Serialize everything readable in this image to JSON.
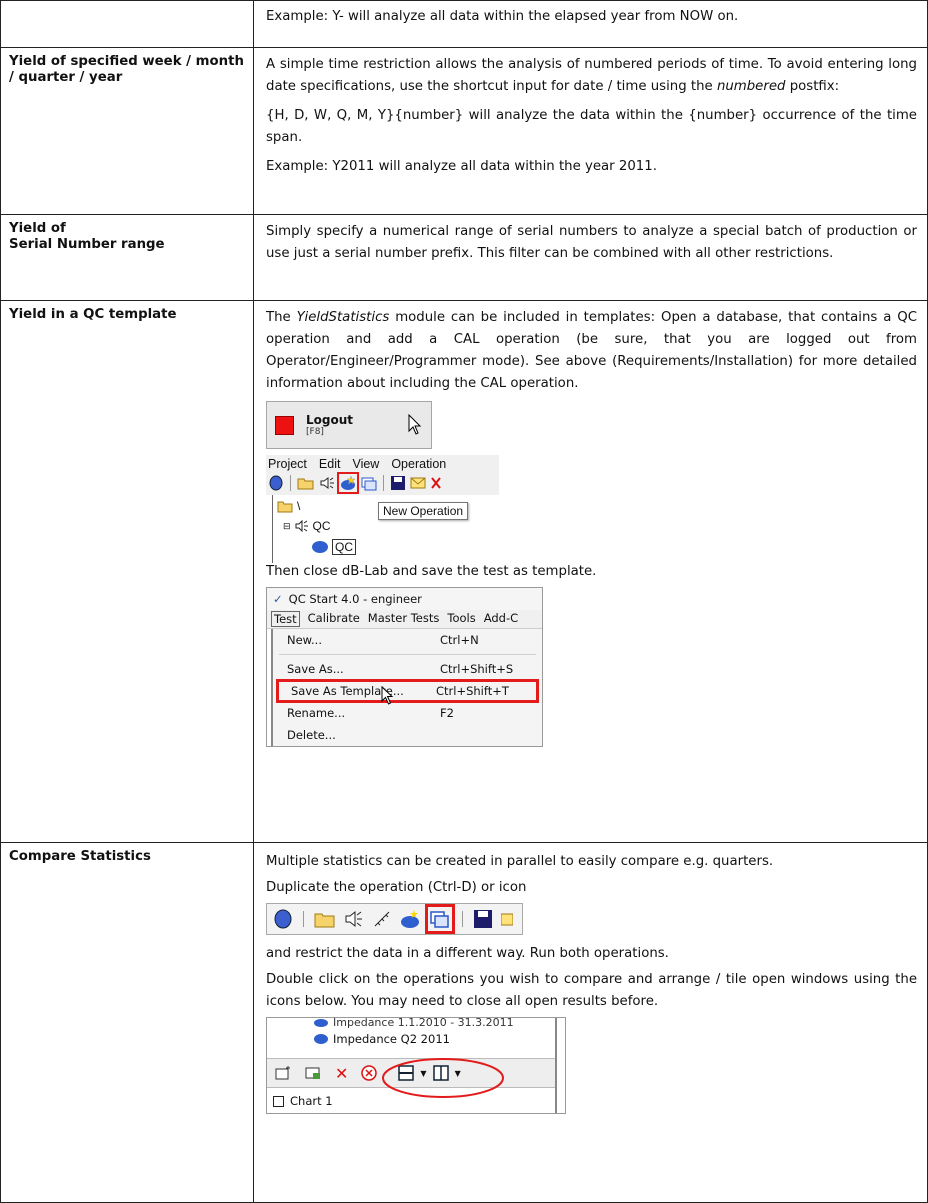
{
  "rows": [
    {
      "label": "",
      "paragraphs": [
        "Example: Y- will analyze all data within the elapsed year from NOW on."
      ]
    },
    {
      "label": "Yield of specified week / month / quarter / year",
      "p1_a": "A simple time restriction allows the analysis of numbered periods of time. To avoid entering long date specifications, use the shortcut input for date / time using the ",
      "p1_em": "numbered",
      "p1_b": " postfix:",
      "p2": "{H, D, W, Q, M, Y}{number} will analyze the data within the {number} occurrence of the time span.",
      "p3": "Example: Y2011 will analyze all data within the year 2011."
    },
    {
      "label_line1": "Yield of",
      "label_line2": "Serial Number range",
      "p1": "Simply specify a numerical range of serial numbers to analyze a special batch of production or use just a serial number prefix. This filter can be combined with all other restrictions."
    },
    {
      "label": "Yield in a QC template",
      "p1_a": "The ",
      "p1_em": "YieldStatistics",
      "p1_b": " module can be included in templates: Open a database, that contains a QC operation and add a CAL operation (be sure, that you are logged out from Operator/Engineer/Programmer mode). See above (Requirements/Installation) for more detailed information about including the CAL operation.",
      "p2": "Then close dB-Lab and save the test as template."
    },
    {
      "label": "Compare Statistics",
      "p1": "Multiple statistics can be created in parallel to easily compare e.g. quarters.",
      "p2": "Duplicate the operation (Ctrl-D) or icon",
      "p3": "and restrict the data in a different way.  Run both operations.",
      "p4": "Double click on the operations you wish to compare and arrange / tile open windows using the icons below. You may need to close all open results before."
    }
  ],
  "logout_shot": {
    "title": "Logout",
    "shortcut": "[F8]"
  },
  "menu_shot": {
    "menus": [
      "Project",
      "Edit",
      "View",
      "Operation"
    ],
    "tooltip": "New Operation",
    "tree_root": "\\",
    "tree_node": "QC",
    "tree_child": "QC"
  },
  "qc_shot": {
    "title": "QC Start  4.0 - engineer",
    "menus": [
      "Test",
      "Calibrate",
      "Master Tests",
      "Tools",
      "Add-C"
    ],
    "items": [
      {
        "label": "New...",
        "shortcut": "Ctrl+N"
      },
      {
        "label": "Save As...",
        "shortcut": "Ctrl+Shift+S"
      },
      {
        "label": "Save As Template...",
        "shortcut": "Ctrl+Shift+T"
      },
      {
        "label": "Rename...",
        "shortcut": "F2"
      },
      {
        "label": "Delete...",
        "shortcut": ""
      }
    ]
  },
  "bottom_shot": {
    "item1": "Impedance 1.1.2010 - 31.3.2011",
    "item2": "Impedance Q2 2011",
    "chart": "Chart 1"
  },
  "colors": {
    "highlight": "#e31b1b",
    "border": "#222222"
  }
}
